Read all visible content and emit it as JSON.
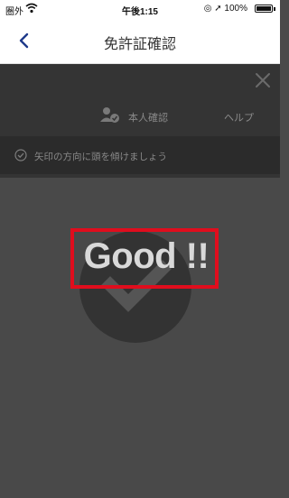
{
  "status": {
    "carrier": "圏外",
    "time": "午後1:15",
    "battery": "100%"
  },
  "nav": {
    "title": "免許証確認"
  },
  "tabs": {
    "identity": "本人確認",
    "help": "ヘルプ"
  },
  "instruction": {
    "text": "矢印の方向に頭を傾けましょう"
  },
  "result": {
    "message": "Good !!"
  },
  "colors": {
    "highlight": "#e00d1d",
    "accent": "#1e3a8a"
  }
}
